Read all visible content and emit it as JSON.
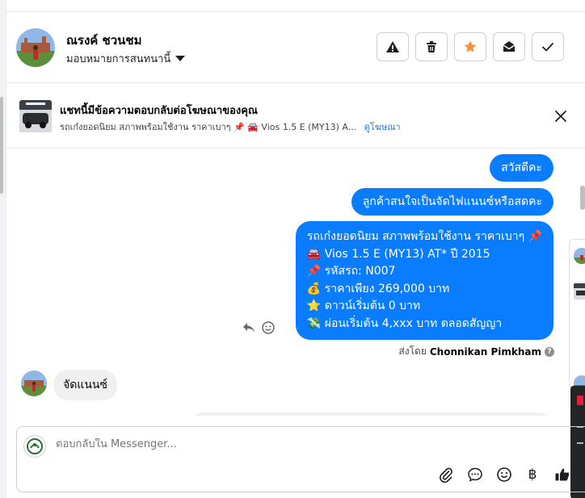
{
  "contact": {
    "name": "ณรงค์ ชวนชม",
    "assign_label": "มอบหมายการสนทนานี้"
  },
  "header_actions": [
    {
      "icon": "warning-icon",
      "color": "#1c1e21"
    },
    {
      "icon": "trash-icon",
      "color": "#1c1e21"
    },
    {
      "icon": "star-icon",
      "color": "#f7923b"
    },
    {
      "icon": "envelope-open-icon",
      "color": "#1c1e21"
    },
    {
      "icon": "check-icon",
      "color": "#1c1e21"
    }
  ],
  "ad_banner": {
    "title": "แชทนี้มีข้อความตอบกลับต่อโฆษณาของคุณ",
    "subtitle": "รถเก๋งยอดนิยม สภาพพร้อมใช้งาน ราคาเบาๆ 📌 🚘 Vios 1.5 E (MY13) A...",
    "link": "ดูโฆษณา"
  },
  "messages": {
    "out_1": "สวัสดีคะ",
    "out_2": "ลูกค้าสนใจเป็นจัดไฟแนนซ์หรือสดคะ",
    "out_3_lines": [
      "รถเก๋งยอดนิยม สภาพพร้อมใช้งาน ราคาเบาๆ 📌",
      "🚘 Vios 1.5 E (MY13) AT* ปี 2015",
      "📌 รหัสรถ: N007",
      "💰 ราคาเพียง 269,000 บาท",
      "⭐ ดาวน์เริ่มต้น 0 บาท",
      "💸 ผ่อนเริ่มต้น 4,xxx บาท ตลอดสัญญา"
    ],
    "sender_prefix": "ส่งโดย",
    "sender_name": "Chonnikan Pimkham",
    "in_1": "จัดแนนซ์"
  },
  "composer": {
    "placeholder": "ตอบกลับใน Messenger...",
    "currency_symbol": "฿"
  },
  "colors": {
    "accent": "#0a7cff",
    "link": "#1b74e4",
    "star": "#f7923b",
    "like": "#1c1e21"
  }
}
